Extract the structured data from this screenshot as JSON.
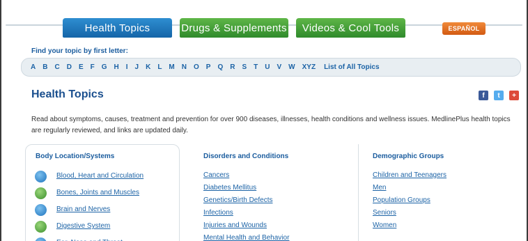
{
  "tabs": {
    "health_topics": "Health Topics",
    "drugs_supplements": "Drugs & Supplements",
    "videos_tools": "Videos & Cool Tools",
    "espanol": "ESPAÑOL"
  },
  "finder": {
    "label": "Find your topic by first letter:",
    "letters": [
      "A",
      "B",
      "C",
      "D",
      "E",
      "F",
      "G",
      "H",
      "I",
      "J",
      "K",
      "L",
      "M",
      "N",
      "O",
      "P",
      "Q",
      "R",
      "S",
      "T",
      "U",
      "V",
      "W",
      "XYZ"
    ],
    "all_topics": "List of All Topics"
  },
  "page": {
    "title": "Health Topics",
    "intro": "Read about symptoms, causes, treatment and prevention for over 900 diseases, illnesses, health conditions and wellness issues. MedlinePlus health topics are regularly reviewed, and links are updated daily."
  },
  "social": {
    "facebook": "f",
    "twitter": "t",
    "google": "+"
  },
  "columns": {
    "body": {
      "heading": "Body Location/Systems",
      "items": [
        {
          "label": "Blood, Heart and Circulation",
          "icon": "heart-icon",
          "color": "#1f74bf"
        },
        {
          "label": "Bones, Joints and Muscles",
          "icon": "bone-icon",
          "color": "#3b8f2c"
        },
        {
          "label": "Brain and Nerves",
          "icon": "brain-icon",
          "color": "#1f74bf"
        },
        {
          "label": "Digestive System",
          "icon": "stomach-icon",
          "color": "#3b8f2c"
        },
        {
          "label": "Ear, Nose and Throat",
          "icon": "ear-icon",
          "color": "#1f74bf"
        }
      ]
    },
    "disorders": {
      "heading": "Disorders and Conditions",
      "items": [
        "Cancers",
        "Diabetes Mellitus",
        "Genetics/Birth Defects",
        "Infections",
        "Injuries and Wounds",
        "Mental Health and Behavior"
      ]
    },
    "demographic": {
      "heading": "Demographic Groups",
      "items": [
        "Children and Teenagers",
        "Men",
        "Population Groups",
        "Seniors",
        "Women"
      ]
    }
  }
}
